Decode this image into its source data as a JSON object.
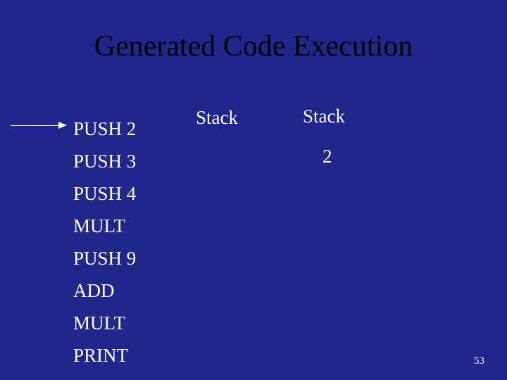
{
  "title": "Generated Code Execution",
  "stackLabel1": "Stack",
  "stackLabel2": "Stack",
  "stackValue": "2",
  "instructions": [
    "PUSH 2",
    "PUSH 3",
    "PUSH 4",
    "MULT",
    "PUSH 9",
    "ADD",
    "MULT",
    "PRINT"
  ],
  "pageNumber": "53"
}
